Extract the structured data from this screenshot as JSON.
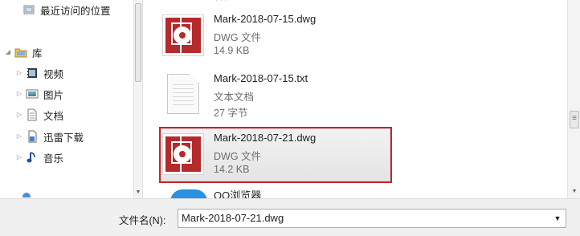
{
  "nav": {
    "items": [
      {
        "label": "最近访问的位置",
        "icon": "recent-places-icon",
        "has_arrow": false
      },
      {
        "label": "库",
        "icon": "library-icon",
        "has_arrow": true,
        "expanded": true
      },
      {
        "label": "视频",
        "icon": "video-icon",
        "has_arrow": true
      },
      {
        "label": "图片",
        "icon": "picture-icon",
        "has_arrow": true
      },
      {
        "label": "文档",
        "icon": "document-icon",
        "has_arrow": true
      },
      {
        "label": "迅雷下载",
        "icon": "thunder-download-icon",
        "has_arrow": true
      },
      {
        "label": "音乐",
        "icon": "music-icon",
        "has_arrow": true
      }
    ]
  },
  "files": [
    {
      "name": "Mark-2018-07-15.dwg",
      "type": "DWG 文件",
      "size": "14.9 KB",
      "icon": "dwg-file-icon",
      "selected": false
    },
    {
      "name": "Mark-2018-07-15.txt",
      "type": "文本文档",
      "size": "27 字节",
      "icon": "text-file-icon",
      "selected": false
    },
    {
      "name": "Mark-2018-07-21.dwg",
      "type": "DWG 文件",
      "size": "14.2 KB",
      "icon": "dwg-file-icon",
      "selected": true
    },
    {
      "name": "QQ浏览器",
      "icon": "qq-browser-icon",
      "partial": true
    }
  ],
  "bottom": {
    "filename_label": "文件名(N):",
    "filename_value": "Mark-2018-07-21.dwg"
  },
  "colors": {
    "selection_border": "#c8232c",
    "dwg_red": "#b52a2d",
    "qq_blue": "#2a90e0"
  }
}
